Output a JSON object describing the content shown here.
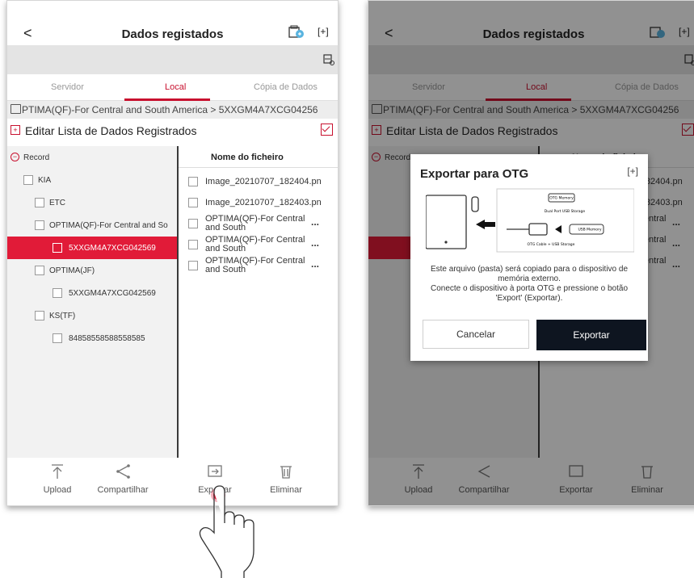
{
  "header": {
    "back_glyph": "<",
    "title": "Dados registados"
  },
  "tabs": [
    {
      "label": "Servidor"
    },
    {
      "label": "Local"
    },
    {
      "label": "Cópia de Dados"
    }
  ],
  "path": {
    "text": "PTIMA(QF)-For Central and South America > 5XXGM4A7XCG04256"
  },
  "edit_list": {
    "label": "Editar Lista de Dados Registrados"
  },
  "tree": [
    {
      "label": "Record"
    },
    {
      "label": "KIA"
    },
    {
      "label": "ETC"
    },
    {
      "label": "OPTIMA(QF)-For Central and So"
    },
    {
      "label": "5XXGM4A7XCG042569"
    },
    {
      "label": "OPTIMA(JF)"
    },
    {
      "label": "5XXGM4A7XCG042569"
    },
    {
      "label": "KS(TF)"
    },
    {
      "label": "84858558588558585"
    }
  ],
  "files": {
    "column_header": "Nome do ficheiro",
    "rows": [
      {
        "name": "Image_20210707_182404.pn"
      },
      {
        "name": "Image_20210707_182403.pn"
      },
      {
        "name": "OPTIMA(QF)-For Central and South",
        "more": "..."
      },
      {
        "name": "OPTIMA(QF)-For Central and South",
        "more": "..."
      },
      {
        "name": "OPTIMA(QF)-For Central and South",
        "more": "..."
      }
    ]
  },
  "bottom_bar": [
    {
      "label": "Upload"
    },
    {
      "label": "Compartilhar"
    },
    {
      "label": "Exportar"
    },
    {
      "label": "Eliminar"
    }
  ],
  "dialog": {
    "title": "Exportar para OTG",
    "diagram_labels": {
      "otg_memory": "OTG Memory",
      "dual_port": "Dual Port USB Storage",
      "usb_memory": "USB Memory",
      "otg_cable": "OTG Cable + USB Storage"
    },
    "message_line1": "Este arquivo (pasta) será copiado para o dispositivo de memória externo.",
    "message_line2": "Conecte o dispositivo à porta OTG e pressione o botão 'Export' (Exportar).",
    "cancel": "Cancelar",
    "export": "Exportar"
  },
  "colors": {
    "accent": "#c8102e",
    "selected_row": "#e11b38",
    "export_button": "#0e1520"
  }
}
